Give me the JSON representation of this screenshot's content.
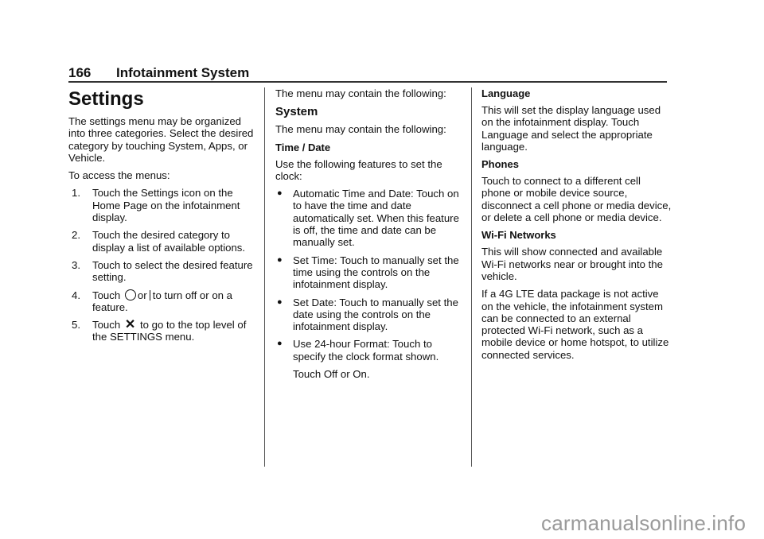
{
  "header": {
    "page_number": "166",
    "section": "Infotainment System"
  },
  "col1": {
    "title": "Settings",
    "intro": "The settings menu may be organized into three categories. Select the desired category by touching System, Apps, or Vehicle.",
    "access_label": "To access the menus:",
    "steps": [
      {
        "num": "1.",
        "text": "Touch the Settings icon on the Home Page on the infotainment display."
      },
      {
        "num": "2.",
        "text": "Touch the desired category to display a list of available options."
      },
      {
        "num": "3.",
        "text": "Touch to select the desired feature setting."
      },
      {
        "num": "4.",
        "pre": "Touch",
        "mid": "or",
        "post": "to turn off or on a feature.",
        "icons": [
          "circle-off-icon",
          "bar-on-icon"
        ]
      },
      {
        "num": "5.",
        "pre": "Touch",
        "post": "to go to the top level of the SETTINGS menu.",
        "icons": [
          "close-x-icon"
        ],
        "x_glyph": "✕"
      }
    ]
  },
  "col2": {
    "intro": "The menu may contain the following:",
    "system_heading": "System",
    "system_intro": "The menu may contain the following:",
    "time_date_heading": "Time / Date",
    "time_date_intro": "Use the following features to set the clock:",
    "bullet_glyph": "●",
    "bullets": [
      "Automatic Time and Date: Touch on to have the time and date automatically set. When this feature is off, the time and date can be manually set.",
      "Set Time: Touch to manually set the time using the controls on the infotainment display.",
      "Set Date: Touch to manually set the date using the controls on the infotainment display.",
      "Use 24-hour Format: Touch to specify the clock format shown."
    ],
    "after_bullets": "Touch Off or On."
  },
  "col3": {
    "language_heading": "Language",
    "language_text": "This will set the display language used on the infotainment display. Touch Language and select the appropriate language.",
    "phones_heading": "Phones",
    "phones_text": "Touch to connect to a different cell phone or mobile device source, disconnect a cell phone or media device, or delete a cell phone or media device.",
    "wifi_heading": "Wi-Fi Networks",
    "wifi_text": "This will show connected and available Wi-Fi networks near or brought into the vehicle.",
    "wifi_text2": "If a 4G LTE data package is not active on the vehicle, the infotainment system can be connected to an external protected Wi-Fi network, such as a mobile device or home hotspot, to utilize connected services."
  },
  "watermark": "carmanualsonline.info"
}
